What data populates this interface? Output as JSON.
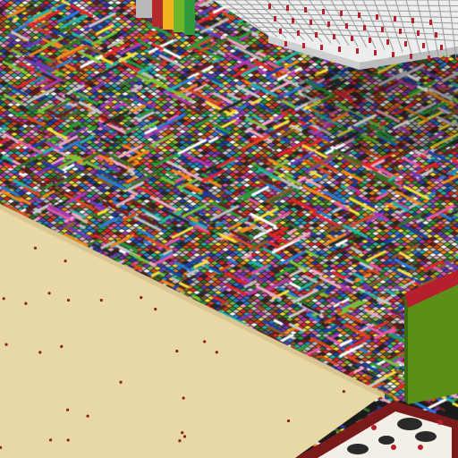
{
  "scene": {
    "view": "isometric",
    "floor_palette": [
      "#e6242b",
      "#f08a1c",
      "#f7e23a",
      "#7cc23a",
      "#2b9a3a",
      "#25b5a8",
      "#2a7bd6",
      "#1f3fa6",
      "#6a3bb8",
      "#b23ab0",
      "#e35aa6",
      "#f4a7c6",
      "#ffffff",
      "#bfbfbf",
      "#2a2a2a",
      "#8b5a2b",
      "#6b1f1f",
      "#d94b1f",
      "#3c6e2a",
      "#c9c9c9"
    ],
    "colors": {
      "sand_floor": "#e7d8a6",
      "sand_edge": "#d8c58f",
      "sand_dot": "#8a1f1f",
      "green_block_front": "#5b8f17",
      "green_block_top": "#7ab12a",
      "green_block_trim": "#b61f2b",
      "white_structure": "#ececec",
      "shadow": "#000000",
      "rug_border": "#7a1a1a",
      "rug_white": "#f3efe6"
    },
    "top_blocks": [
      {
        "color": "#b22a2a"
      },
      {
        "color": "#f0b51c"
      },
      {
        "color": "#6fb52a"
      },
      {
        "color": "#2f9b3a"
      }
    ],
    "sand_dot_count": 28
  }
}
